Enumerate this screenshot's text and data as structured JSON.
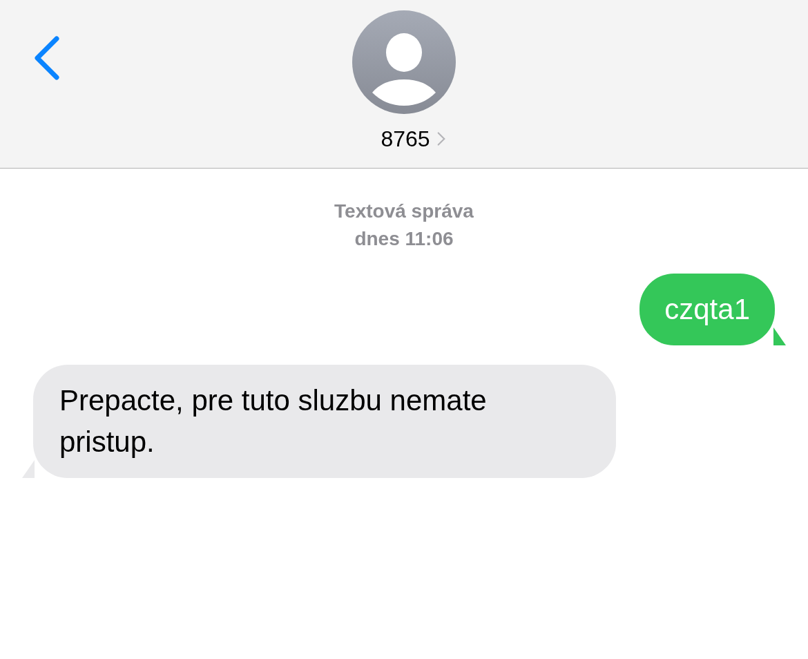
{
  "contact": {
    "name": "8765"
  },
  "timestamp": {
    "label": "Textová správa",
    "time": "dnes 11:06"
  },
  "messages": [
    {
      "kind": "sent",
      "text": "czqta1"
    },
    {
      "kind": "received",
      "text": "Prepacte, pre tuto sluzbu nemate pristup."
    }
  ]
}
